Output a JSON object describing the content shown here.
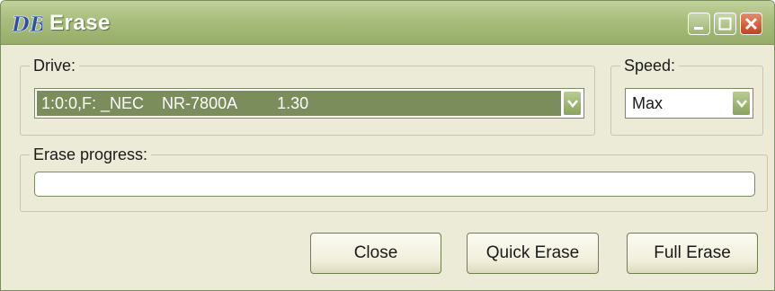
{
  "window": {
    "title": "Erase",
    "app_icon": "db-logo-icon",
    "controls": [
      "minimize-icon",
      "maximize-icon",
      "close-icon"
    ]
  },
  "drive_group": {
    "label": "Drive:",
    "selected": "1:0:0,F: _NEC    NR-7800A         1.30"
  },
  "speed_group": {
    "label": "Speed:",
    "selected": "Max"
  },
  "progress_group": {
    "label": "Erase progress:",
    "progress": 0
  },
  "buttons": {
    "close": "Close",
    "quick_erase": "Quick Erase",
    "full_erase": "Full Erase"
  },
  "colors": {
    "title_bar": "#a8bd7c",
    "selection": "#7b8d5a",
    "window_bg": "#ecebd8",
    "close_button": "#c3411f"
  }
}
